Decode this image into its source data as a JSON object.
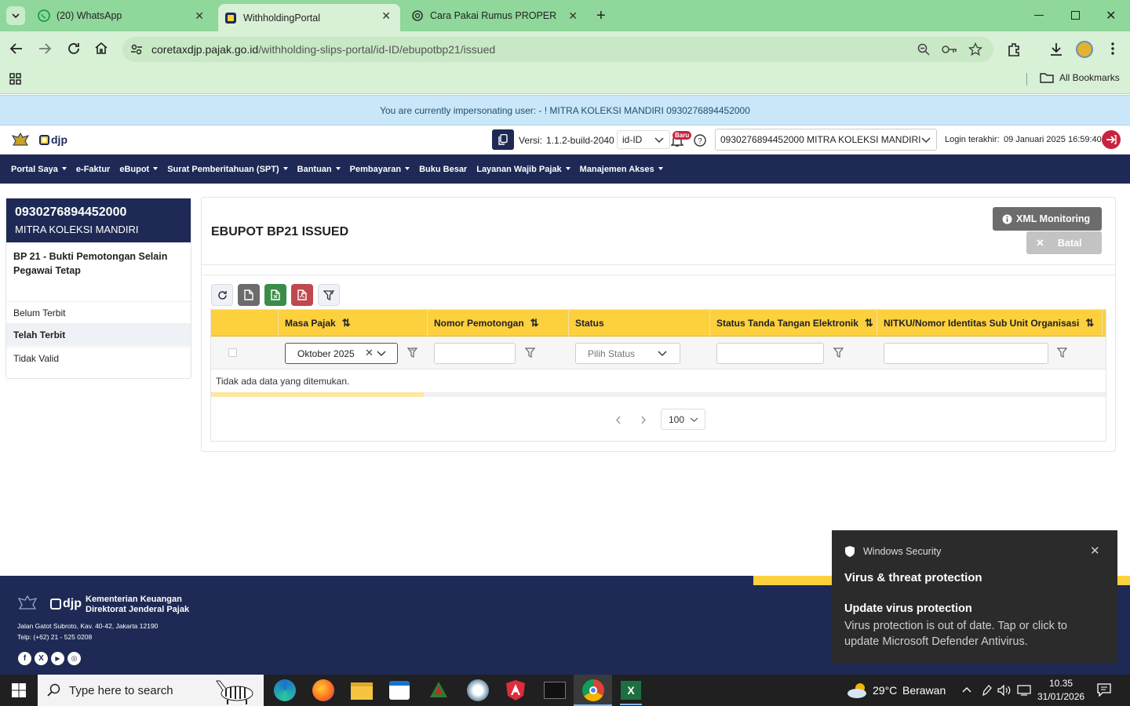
{
  "browser": {
    "tabs": [
      {
        "title": "(20) WhatsApp"
      },
      {
        "title": "WithholdingPortal"
      },
      {
        "title": "Cara Pakai Rumus PROPER"
      }
    ],
    "url_host": "coretaxdjp.pajak.go.id",
    "url_path": "/withholding-slips-portal/id-ID/ebupotbp21/issued",
    "bookmarks_label": "All Bookmarks"
  },
  "impersonation_banner": "You are currently impersonating user: - ! MITRA KOLEKSI MANDIRI 0930276894452000",
  "header": {
    "logo_text": "djp",
    "version_label": "Versi:",
    "version_value": "1.1.2-build-2040",
    "locale": "id-ID",
    "new_badge": "Baru",
    "taxpayer_select": "0930276894452000 MITRA KOLEKSI MANDIRI",
    "last_login_label": "Login terakhir:",
    "last_login_value": "09 Januari 2025 16:59:40"
  },
  "nav": [
    "Portal Saya",
    "e-Faktur",
    "eBupot",
    "Surat Pemberitahuan (SPT)",
    "Bantuan",
    "Pembayaran",
    "Buku Besar",
    "Layanan Wajib Pajak",
    "Manajemen Akses"
  ],
  "sidebar": {
    "npwp": "0930276894452000",
    "name": "MITRA KOLEKSI MANDIRI",
    "section_title": "BP 21 - Bukti Pemotongan Selain Pegawai Tetap",
    "items": [
      "Belum Terbit",
      "Telah Terbit",
      "Tidak Valid"
    ],
    "active_item": "Telah Terbit"
  },
  "main": {
    "title": "EBUPOT BP21 ISSUED",
    "xml_button": "XML Monitoring",
    "cancel_button": "Batal",
    "columns": [
      "Masa Pajak",
      "Nomor Pemotongan",
      "Status",
      "Status Tanda Tangan Elektronik",
      "NITKU/Nomor Identitas Sub Unit Organisasi"
    ],
    "filter_masa_pajak": "Oktober 2025",
    "filter_status_placeholder": "Pilih Status",
    "empty_message": "Tidak ada data yang ditemukan.",
    "page_size": "100"
  },
  "footer": {
    "ministry": "Kementerian Keuangan",
    "directorate": "Direktorat Jenderal Pajak",
    "address": "Jalan Gatot Subroto, Kav. 40-42, Jakarta 12190",
    "phone": "Telp: (+62) 21 - 525 0208"
  },
  "toast": {
    "app": "Windows Security",
    "heading": "Virus & threat protection",
    "title": "Update virus protection",
    "body": "Virus protection is out of date. Tap or click to update Microsoft Defender Antivirus."
  },
  "taskbar": {
    "search_placeholder": "Type here to search",
    "weather": "29°C",
    "weather_desc": "Berawan",
    "time": "10.35",
    "date": "31/01/2026"
  },
  "colors": {
    "navy": "#1e2a55",
    "yellow": "#fdd03e",
    "chrome_green": "#8fd79a"
  }
}
